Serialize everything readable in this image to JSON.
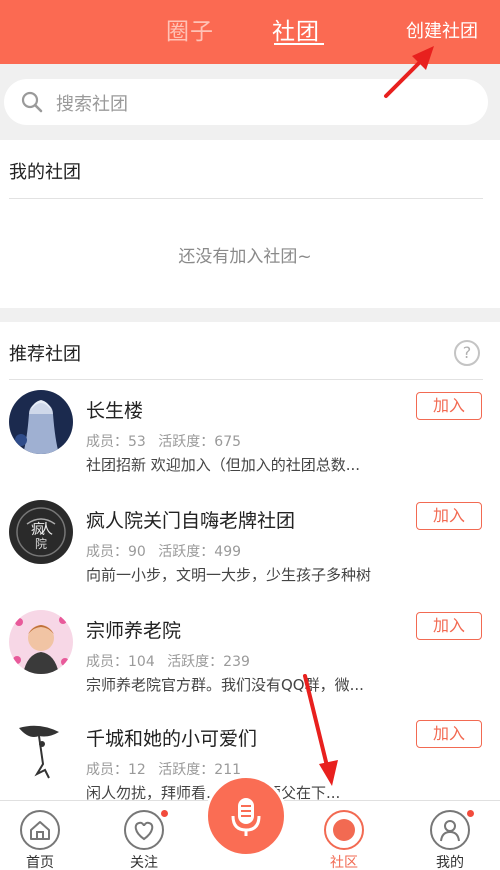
{
  "header": {
    "tabs": [
      {
        "label": "圈子",
        "active": false
      },
      {
        "label": "社团",
        "active": true
      }
    ],
    "create_label": "创建社团",
    "accent_color": "#fb6a52"
  },
  "search": {
    "placeholder": "搜索社团",
    "icon": "search-icon"
  },
  "my_clubs": {
    "title": "我的社团",
    "empty_text": "还没有加入社团~"
  },
  "recommended": {
    "title": "推荐社团",
    "help_glyph": "?",
    "clubs": [
      {
        "name": "长生楼",
        "members_label": "成员：53",
        "activity_label": "活跃度：675",
        "desc": "社团招新 欢迎加入（但加入的社团总数...",
        "join_label": "加入"
      },
      {
        "name": "疯人院关门自嗨老牌社团",
        "members_label": "成员：90",
        "activity_label": "活跃度：499",
        "desc": "向前一小步，文明一大步，少生孩子多种树",
        "join_label": "加入"
      },
      {
        "name": "宗师养老院",
        "members_label": "成员：104",
        "activity_label": "活跃度：239",
        "desc": "宗师养老院官方群。我们没有QQ群，微...",
        "join_label": "加入"
      },
      {
        "name": "千城和她的小可爱们",
        "members_label": "成员：12",
        "activity_label": "活跃度：211",
        "desc": "闲人勿扰，拜师看…私聊，师父在下...",
        "join_label": "加入"
      }
    ]
  },
  "bottom_nav": {
    "items": [
      {
        "label": "首页",
        "icon": "home-icon"
      },
      {
        "label": "关注",
        "icon": "heart-icon"
      },
      {
        "label": "社区",
        "icon": "community-icon",
        "active": true
      },
      {
        "label": "我的",
        "icon": "profile-icon"
      }
    ],
    "mic_icon": "microphone-icon"
  }
}
